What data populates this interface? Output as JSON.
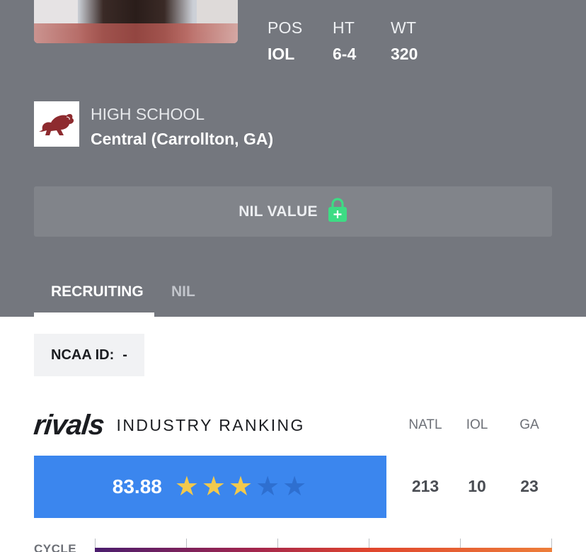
{
  "profile": {
    "stats": [
      {
        "label": "POS",
        "value": "IOL"
      },
      {
        "label": "HT",
        "value": "6-4"
      },
      {
        "label": "WT",
        "value": "320"
      }
    ],
    "school": {
      "label": "HIGH SCHOOL",
      "name": "Central (Carrollton, GA)",
      "logo_icon": "lion-mascot-icon"
    },
    "nil": {
      "label": "NIL VALUE",
      "icon": "lock-plus-icon",
      "icon_color": "#3ddc84"
    }
  },
  "tabs": [
    {
      "label": "RECRUITING",
      "active": true
    },
    {
      "label": "NIL",
      "active": false
    }
  ],
  "ncaa": {
    "label": "NCAA ID:",
    "value": "-"
  },
  "ranking": {
    "brand": "rivals",
    "title": "INDUSTRY RANKING",
    "columns": [
      "NATL",
      "IOL",
      "GA"
    ],
    "values": [
      "213",
      "10",
      "23"
    ],
    "rating": "83.88",
    "stars_filled": 3,
    "stars_total": 5,
    "accent_color": "#3b86ee"
  },
  "cycle": {
    "label": "CYCLE"
  }
}
